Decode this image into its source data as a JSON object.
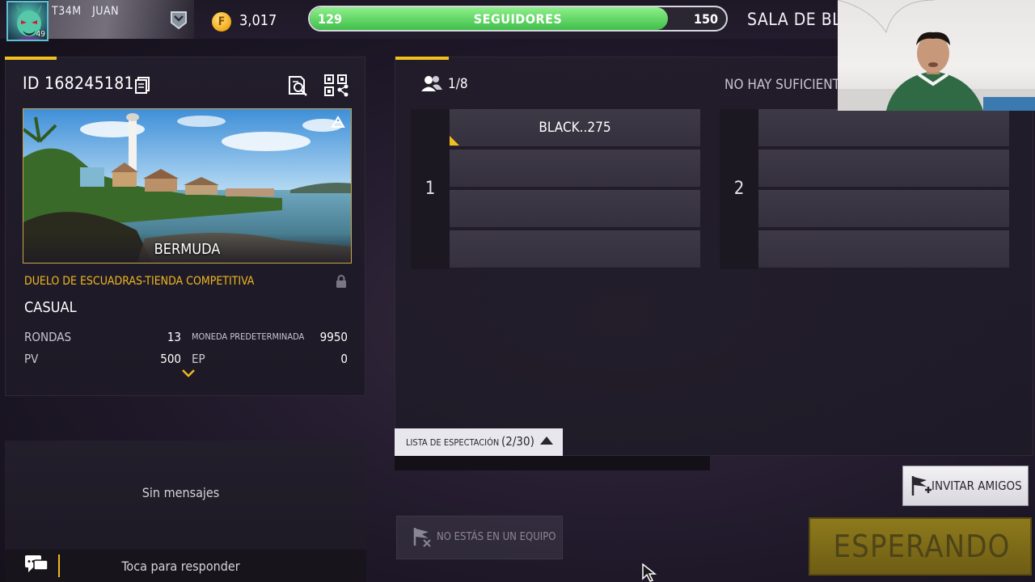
{
  "header": {
    "player_name": "T34M   JUAN",
    "player_level": "49",
    "coins": "3,017",
    "coin_symbol": "F",
    "followers": {
      "current": "129",
      "label": "SEGUIDORES",
      "goal": "150",
      "progress": 0.86
    },
    "room_title": "SALA DE BLA"
  },
  "room": {
    "id_label": "ID 168245181",
    "map_name": "BERMUDA",
    "mode_title": "DUELO DE ESCUADRAS-TIENDA COMPETITIVA",
    "mode_type": "CASUAL",
    "stats": [
      {
        "label": "RONDAS",
        "value": "13"
      },
      {
        "label": "MONEDA PREDETERMINADA",
        "value": "9950"
      },
      {
        "label": "PV",
        "value": "500"
      },
      {
        "label": "EP",
        "value": "0"
      }
    ]
  },
  "chat": {
    "empty_text": "Sin mensajes",
    "reply_placeholder": "Toca para responder"
  },
  "teams": {
    "player_count": "1/8",
    "status_text": "NO HAY SUFICIENT",
    "team1": {
      "number": "1",
      "slots": [
        "BLACK..275",
        "",
        "",
        ""
      ]
    },
    "team2": {
      "number": "2",
      "slots": [
        "",
        "",
        "",
        ""
      ]
    }
  },
  "spectate": {
    "label": "LISTA DE ESPECTACIÓN",
    "count": "(2/30)"
  },
  "buttons": {
    "invite": "INVITAR AMIGOS",
    "no_team": "NO ESTÁS EN UN EQUIPO",
    "waiting": "ESPERANDO"
  },
  "colors": {
    "accent": "#f0c020",
    "follower_fill": "#4fcf58",
    "mode_title": "#f0b820"
  }
}
